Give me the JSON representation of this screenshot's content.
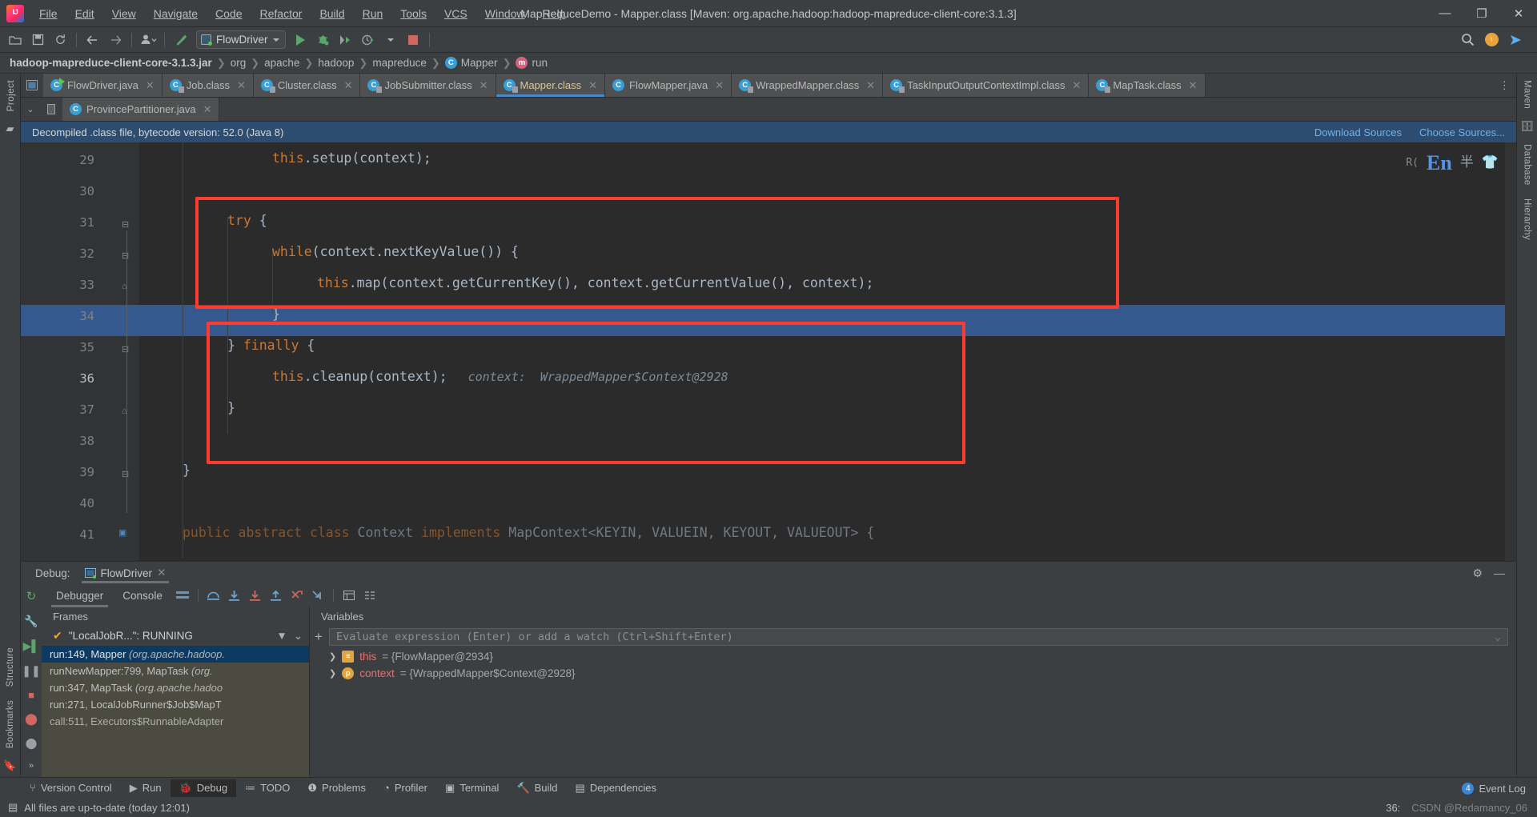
{
  "window": {
    "title": "MapReduceDemo - Mapper.class [Maven: org.apache.hadoop:hadoop-mapreduce-client-core:3.1.3]",
    "minimize": "—",
    "maximize": "❐",
    "close": "✕"
  },
  "menubar": [
    {
      "label": "File"
    },
    {
      "label": "Edit"
    },
    {
      "label": "View"
    },
    {
      "label": "Navigate"
    },
    {
      "label": "Code"
    },
    {
      "label": "Refactor"
    },
    {
      "label": "Build"
    },
    {
      "label": "Run"
    },
    {
      "label": "Tools"
    },
    {
      "label": "VCS"
    },
    {
      "label": "Window"
    },
    {
      "label": "Help"
    }
  ],
  "toolbar": {
    "run_config": "FlowDriver",
    "icons": [
      "open-folder-icon",
      "save-icon",
      "sync-icon",
      "back-arrow-icon",
      "forward-arrow-icon",
      "profile-icon",
      "build-hammer-icon",
      "run-icon",
      "debug-icon",
      "run-coverage-icon",
      "profiler-icon",
      "stop-icon",
      "search-icon",
      "updates-icon",
      "share-icon"
    ]
  },
  "breadcrumb": [
    {
      "label": "hadoop-mapreduce-client-core-3.1.3.jar",
      "bold": true,
      "badge": ""
    },
    {
      "label": "org",
      "bold": false,
      "badge": ""
    },
    {
      "label": "apache",
      "bold": false,
      "badge": ""
    },
    {
      "label": "hadoop",
      "bold": false,
      "badge": ""
    },
    {
      "label": "mapreduce",
      "bold": false,
      "badge": ""
    },
    {
      "label": "Mapper",
      "bold": false,
      "badge": "C"
    },
    {
      "label": "run",
      "bold": false,
      "badge": "m"
    }
  ],
  "editor_tabs_row1": [
    {
      "label": "FlowDriver.java",
      "type": "java",
      "active": false
    },
    {
      "label": "Job.class",
      "type": "class",
      "active": false
    },
    {
      "label": "Cluster.class",
      "type": "class",
      "active": false
    },
    {
      "label": "JobSubmitter.class",
      "type": "class",
      "active": false
    },
    {
      "label": "Mapper.class",
      "type": "class",
      "active": true
    },
    {
      "label": "FlowMapper.java",
      "type": "javaplain",
      "active": false
    },
    {
      "label": "WrappedMapper.class",
      "type": "class",
      "active": false
    },
    {
      "label": "TaskInputOutputContextImpl.class",
      "type": "class",
      "active": false
    },
    {
      "label": "MapTask.class",
      "type": "class",
      "active": false
    }
  ],
  "editor_tabs_row2": [
    {
      "label": "ProvincePartitioner.java",
      "type": "javaplain",
      "active": false
    }
  ],
  "notification": {
    "message": "Decompiled .class file, bytecode version: 52.0 (Java 8)",
    "link_download": "Download Sources",
    "link_choose": "Choose Sources..."
  },
  "editor": {
    "lines": [
      {
        "num": "29",
        "indent": 3,
        "fold": "",
        "segments": [
          {
            "t": "this",
            "c": "kw"
          },
          {
            "t": ".setup(context);",
            "c": "pl"
          }
        ]
      },
      {
        "num": "30",
        "indent": 0,
        "fold": "",
        "segments": []
      },
      {
        "num": "31",
        "indent": 2,
        "fold": "minus",
        "segments": [
          {
            "t": "try",
            "c": "kw"
          },
          {
            "t": " {",
            "c": "pl"
          }
        ]
      },
      {
        "num": "32",
        "indent": 3,
        "fold": "minus",
        "segments": [
          {
            "t": "while",
            "c": "kw"
          },
          {
            "t": "(context.nextKeyValue()) {",
            "c": "pl"
          }
        ]
      },
      {
        "num": "33",
        "indent": 4,
        "fold": "",
        "segments": [
          {
            "t": "this",
            "c": "kw"
          },
          {
            "t": ".map(context.getCurrentKey(), context.getCurrentValue(), context);",
            "c": "pl"
          }
        ]
      },
      {
        "num": "34",
        "indent": 3,
        "fold": "up",
        "segments": [
          {
            "t": "}",
            "c": "pl"
          }
        ]
      },
      {
        "num": "35",
        "indent": 2,
        "fold": "minus",
        "segments": [
          {
            "t": "} ",
            "c": "pl"
          },
          {
            "t": "finally",
            "c": "kw"
          },
          {
            "t": " {",
            "c": "pl"
          }
        ]
      },
      {
        "num": "36",
        "indent": 3,
        "fold": "",
        "highlight": true,
        "segments": [
          {
            "t": "this",
            "c": "kw"
          },
          {
            "t": ".cleanup(context);",
            "c": "pl"
          }
        ],
        "inline_hint": "context:  WrappedMapper$Context@2928"
      },
      {
        "num": "37",
        "indent": 2,
        "fold": "up",
        "segments": [
          {
            "t": "}",
            "c": "pl"
          }
        ]
      },
      {
        "num": "38",
        "indent": 0,
        "fold": "",
        "segments": []
      },
      {
        "num": "39",
        "indent": 1,
        "fold": "minus",
        "segments": [
          {
            "t": "}",
            "c": "pl"
          }
        ]
      },
      {
        "num": "40",
        "indent": 0,
        "fold": "",
        "segments": []
      },
      {
        "num": "41",
        "indent": 1,
        "fold": "",
        "clipped": true,
        "segments": [
          {
            "t": "public abstract class",
            "c": "kw"
          },
          {
            "t": " Context ",
            "c": "pl"
          },
          {
            "t": "implements",
            "c": "kw"
          },
          {
            "t": " MapContext<KEYIN, VALUEIN, KEYOUT, VALUEOUT> {",
            "c": "pl"
          }
        ]
      }
    ],
    "float_badges": {
      "en": "En",
      "ru_prefix": "R(",
      "icons": [
        "chinese-input-icon",
        "plugin-icon",
        "database-icon"
      ]
    }
  },
  "right_rail": [
    "Maven",
    "Database",
    "Hierarchy"
  ],
  "left_rail": [
    "Project",
    "Structure",
    "Bookmarks"
  ],
  "debug": {
    "title_label": "Debug:",
    "session_tab": "FlowDriver",
    "tabs": [
      {
        "label": "Debugger",
        "selected": true
      },
      {
        "label": "Console",
        "selected": false
      }
    ],
    "toolbar_icons": [
      "layout-icon",
      "step-over-icon",
      "step-into-icon",
      "force-step-into-icon",
      "step-out-icon",
      "drop-frame-icon",
      "run-to-cursor-icon",
      "evaluate-icon",
      "settings-icon"
    ],
    "frames_header": "Frames",
    "variables_header": "Variables",
    "thread": "\"LocalJobR...\": RUNNING",
    "frames": [
      {
        "label": "run:149, Mapper",
        "pkg": "(org.apache.hadoop.",
        "selected": true
      },
      {
        "label": "runNewMapper:799, MapTask",
        "pkg": "(org.",
        "selected": false
      },
      {
        "label": "run:347, MapTask",
        "pkg": "(org.apache.hadoo",
        "selected": false
      },
      {
        "label": "run:271, LocalJobRunner$Job$MapT",
        "pkg": "",
        "selected": false
      },
      {
        "label": "call:511, Executors$RunnableAdapter",
        "pkg": "",
        "selected": false
      }
    ],
    "evaluate_placeholder": "Evaluate expression (Enter) or add a watch (Ctrl+Shift+Enter)",
    "variables": [
      {
        "badge": "f",
        "badge_char": "≡",
        "name": "this",
        "value": "= {FlowMapper@2934}"
      },
      {
        "badge": "p",
        "badge_char": "p",
        "name": "context",
        "value": "= {WrappedMapper$Context@2928}"
      }
    ]
  },
  "toolwindow_bar": [
    {
      "label": "Version Control",
      "icon": "branch-icon",
      "active": false
    },
    {
      "label": "Run",
      "icon": "run-icon",
      "active": false
    },
    {
      "label": "Debug",
      "icon": "debug-icon",
      "active": true
    },
    {
      "label": "TODO",
      "icon": "todo-icon",
      "active": false
    },
    {
      "label": "Problems",
      "icon": "problems-icon",
      "active": false
    },
    {
      "label": "Profiler",
      "icon": "profiler-icon",
      "active": false
    },
    {
      "label": "Terminal",
      "icon": "terminal-icon",
      "active": false
    },
    {
      "label": "Build",
      "icon": "build-icon",
      "active": false
    },
    {
      "label": "Dependencies",
      "icon": "dependencies-icon",
      "active": false
    }
  ],
  "statusbar": {
    "message": "All files are up-to-date (today 12:01)",
    "caret_position": "36:",
    "event_log": "Event Log",
    "event_count": "4",
    "watermark": "CSDN @Redamancy_06"
  }
}
